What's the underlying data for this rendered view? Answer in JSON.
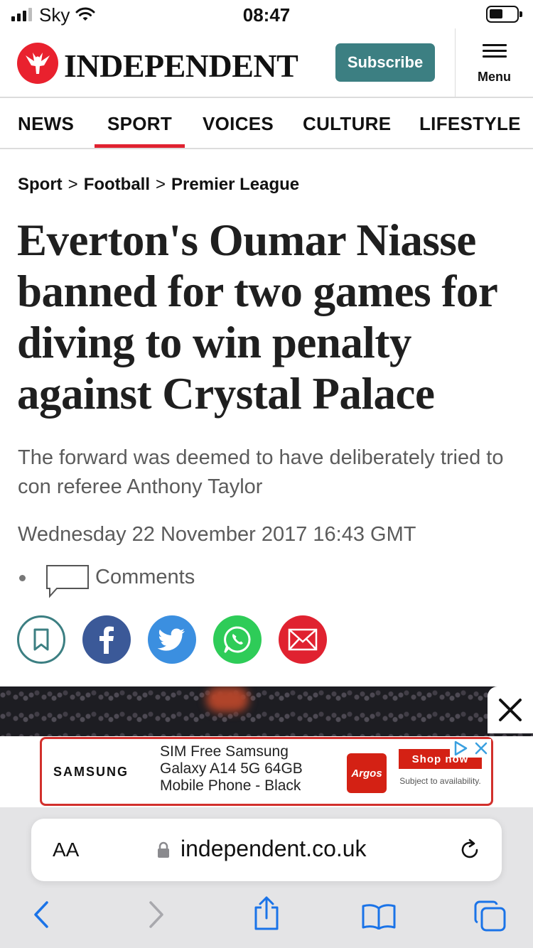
{
  "status_bar": {
    "carrier": "Sky",
    "time": "08:47"
  },
  "header": {
    "brand": "INDEPENDENT",
    "subscribe_label": "Subscribe",
    "menu_label": "Menu"
  },
  "nav": {
    "items": [
      {
        "label": "NEWS",
        "active": false
      },
      {
        "label": "SPORT",
        "active": true
      },
      {
        "label": "VOICES",
        "active": false
      },
      {
        "label": "CULTURE",
        "active": false
      },
      {
        "label": "LIFESTYLE",
        "active": false
      }
    ]
  },
  "breadcrumb": {
    "items": [
      "Sport",
      "Football",
      "Premier League"
    ],
    "separator": ">"
  },
  "article": {
    "headline": "Everton's Oumar Niasse banned for two games for diving to win penalty against Crystal Palace",
    "standfirst": "The forward was deemed to have deliberately tried to con referee Anthony Taylor",
    "dateline": "Wednesday 22 November 2017 16:43 GMT",
    "comments_label": "Comments"
  },
  "share": {
    "buttons": [
      {
        "name": "bookmark",
        "color": "#3c7f82"
      },
      {
        "name": "facebook",
        "color": "#3b5998"
      },
      {
        "name": "twitter",
        "color": "#1da1f2"
      },
      {
        "name": "whatsapp",
        "color": "#25d366"
      },
      {
        "name": "email",
        "color": "#e02230"
      }
    ]
  },
  "ad": {
    "brand": "SAMSUNG",
    "description": "SIM Free Samsung Galaxy A14 5G 64GB Mobile Phone - Black",
    "retailer": "Argos",
    "cta": "Shop now",
    "note": "Subject to availability."
  },
  "browser": {
    "text_size_label": "AA",
    "url": "independent.co.uk"
  },
  "colors": {
    "brand_red": "#e9212e",
    "subscribe_teal": "#3c7f82",
    "nav_active": "#e02230",
    "safari_blue": "#1a73e8"
  }
}
